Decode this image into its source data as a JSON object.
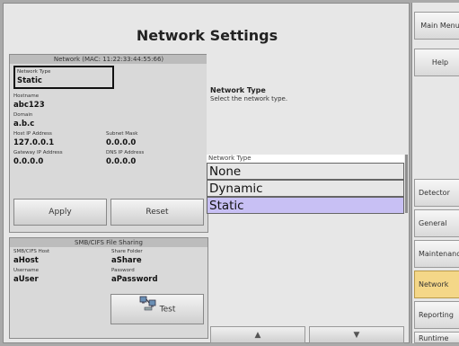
{
  "title": "Network Settings",
  "network_panel": {
    "header": "Network (MAC: 11:22:33:44:55:66)",
    "network_type_label": "Network Type",
    "network_type_value": "Static",
    "hostname_label": "Hostname",
    "hostname_value": "abc123",
    "domain_label": "Domain",
    "domain_value": "a.b.c",
    "host_ip_label": "Host IP Address",
    "host_ip_value": "127.0.0.1",
    "subnet_label": "Subnet Mask",
    "subnet_value": "0.0.0.0",
    "gateway_label": "Gateway IP Address",
    "gateway_value": "0.0.0.0",
    "dns_label": "DNS IP Address",
    "dns_value": "0.0.0.0",
    "apply_label": "Apply",
    "reset_label": "Reset"
  },
  "smb_panel": {
    "header": "SMB/CIFS File Sharing",
    "host_label": "SMB/CIFS Host",
    "host_value": "aHost",
    "share_label": "Share Folder",
    "share_value": "aShare",
    "username_label": "Username",
    "username_value": "aUser",
    "password_label": "Password",
    "password_value": "aPassword",
    "test_label": "Test"
  },
  "info": {
    "title": "Network Type",
    "desc": "Select the network type."
  },
  "dropdown": {
    "label": "Network Type",
    "options": [
      "None",
      "Dynamic",
      "Static"
    ],
    "selected": "Static"
  },
  "sidebar": {
    "main_menu": "Main Menu",
    "help": "Help",
    "items": [
      "Detector",
      "General",
      "Maintenance",
      "Network",
      "Reporting",
      "Runtime"
    ],
    "active": "Network"
  },
  "colors": {
    "selected_option": "#c8c0f4",
    "active_tab": "#f4d788"
  }
}
